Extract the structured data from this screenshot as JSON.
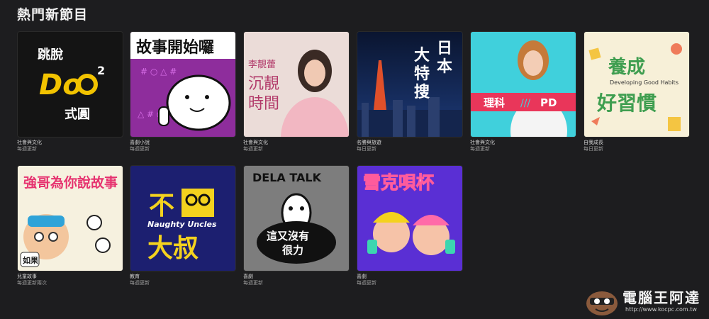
{
  "section": {
    "title": "熱門新節目"
  },
  "shows": [
    {
      "art_title": "跳脫Do²式圓",
      "category": "社會與文化",
      "frequency": "每週更新"
    },
    {
      "art_title": "故事開始囉",
      "category": "喜劇小說",
      "frequency": "每週更新"
    },
    {
      "art_title": "李靚蕾 沉靚時間",
      "category": "社會與文化",
      "frequency": "每週更新"
    },
    {
      "art_title": "日本大特搜",
      "category": "名勝與旅遊",
      "frequency": "每日更新"
    },
    {
      "art_title": "理科PD",
      "category": "社會與文化",
      "frequency": "每週更新"
    },
    {
      "art_title": "養成好習慣",
      "art_subtitle": "Developing Good Habits",
      "category": "自我成長",
      "frequency": "每日更新"
    },
    {
      "art_title": "強哥為你說故事",
      "art_badge": "如果",
      "category": "兒童故事",
      "frequency": "每週更新兩次"
    },
    {
      "art_title": "不要大叔",
      "art_subtitle": "Naughty Uncles",
      "category": "教育",
      "frequency": "每週更新"
    },
    {
      "art_title": "DELA TALK",
      "art_subtitle": "這又沒有很力",
      "category": "喜劇",
      "frequency": "每週更新"
    },
    {
      "art_title": "雪克唄杯",
      "category": "喜劇",
      "frequency": "每週更新"
    }
  ],
  "watermark": {
    "text": "電腦王阿達",
    "url": "http://www.kocpc.com.tw"
  },
  "colors": {
    "background": "#1d1d1f"
  }
}
